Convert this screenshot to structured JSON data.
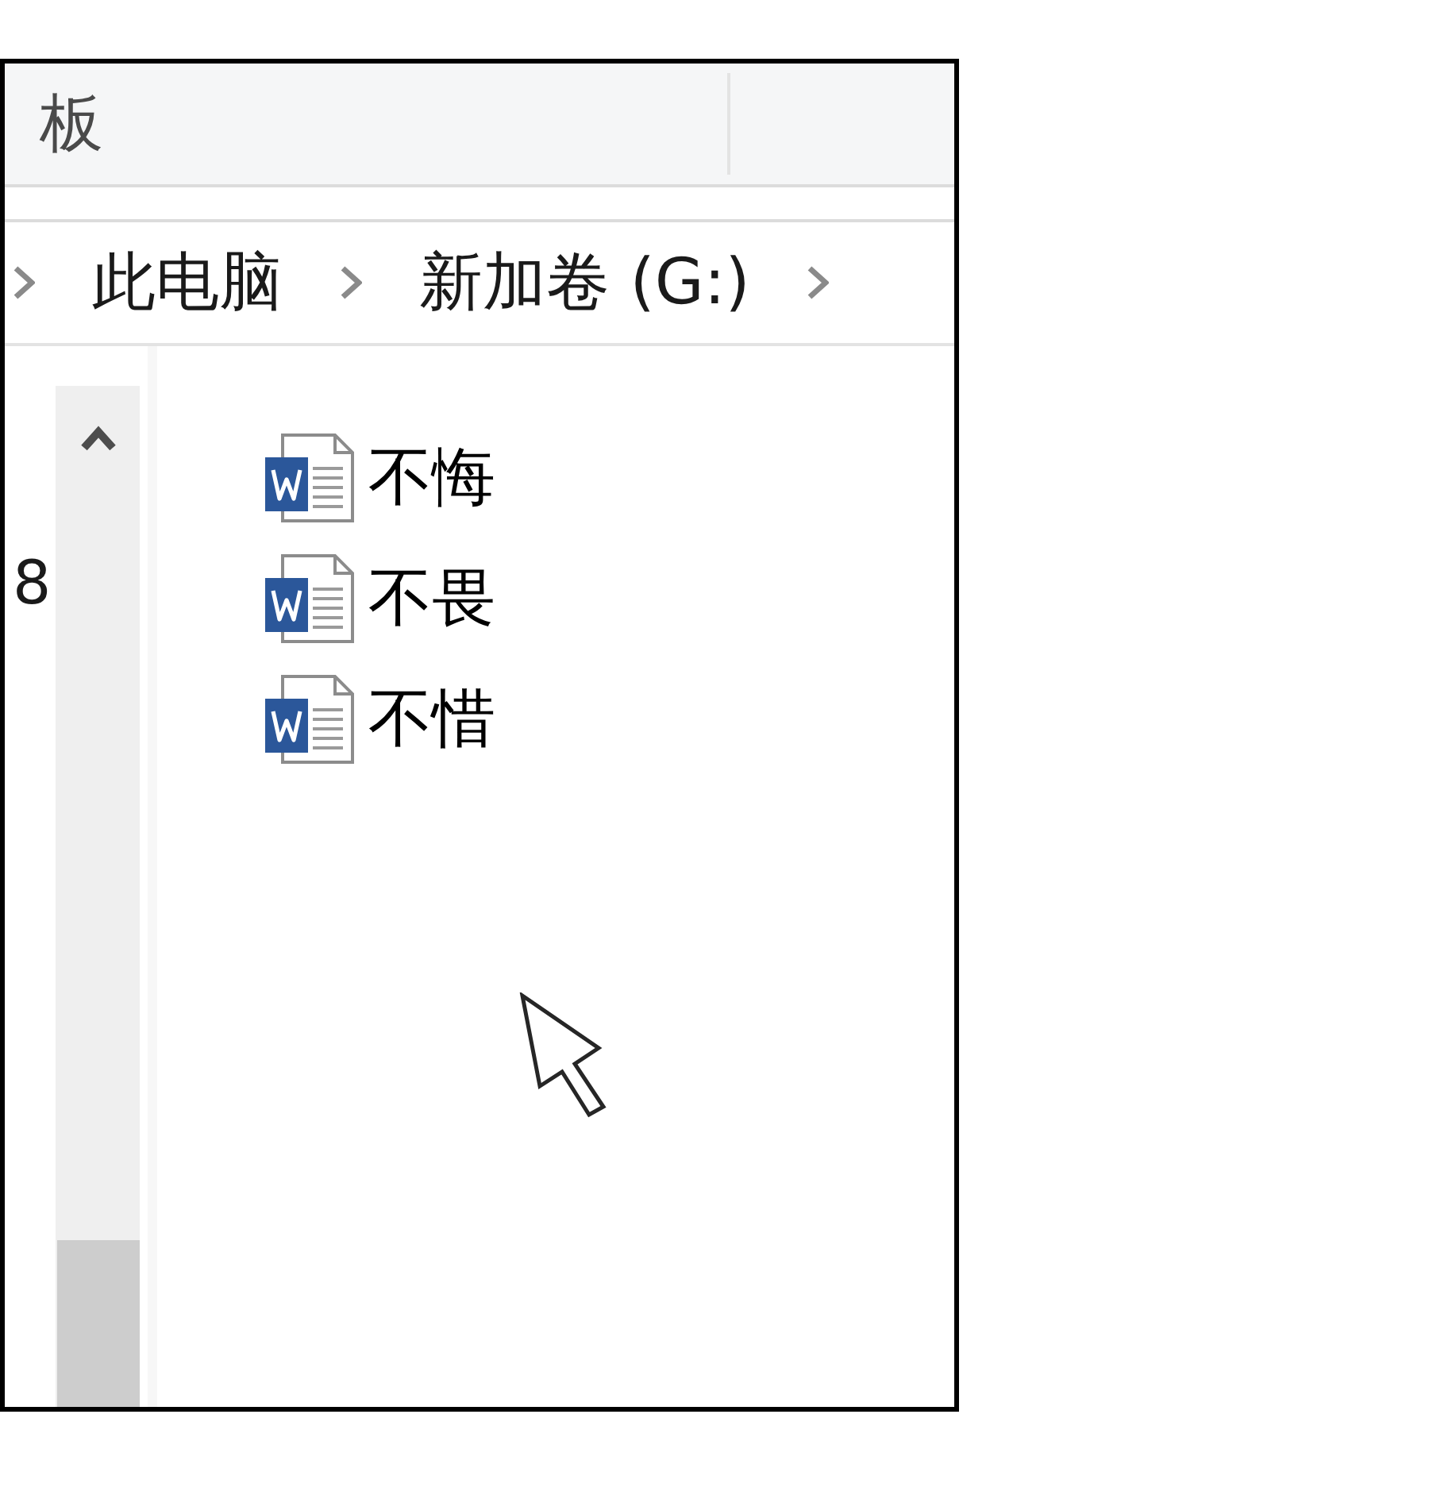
{
  "ribbon": {
    "group_label": "板"
  },
  "address_bar": {
    "path": [
      "此电脑",
      "新加卷 (G:)"
    ]
  },
  "navigation_pane": {
    "items": [
      "8"
    ]
  },
  "files": [
    {
      "name": "不悔"
    },
    {
      "name": "不畏"
    },
    {
      "name": "不惜"
    }
  ]
}
